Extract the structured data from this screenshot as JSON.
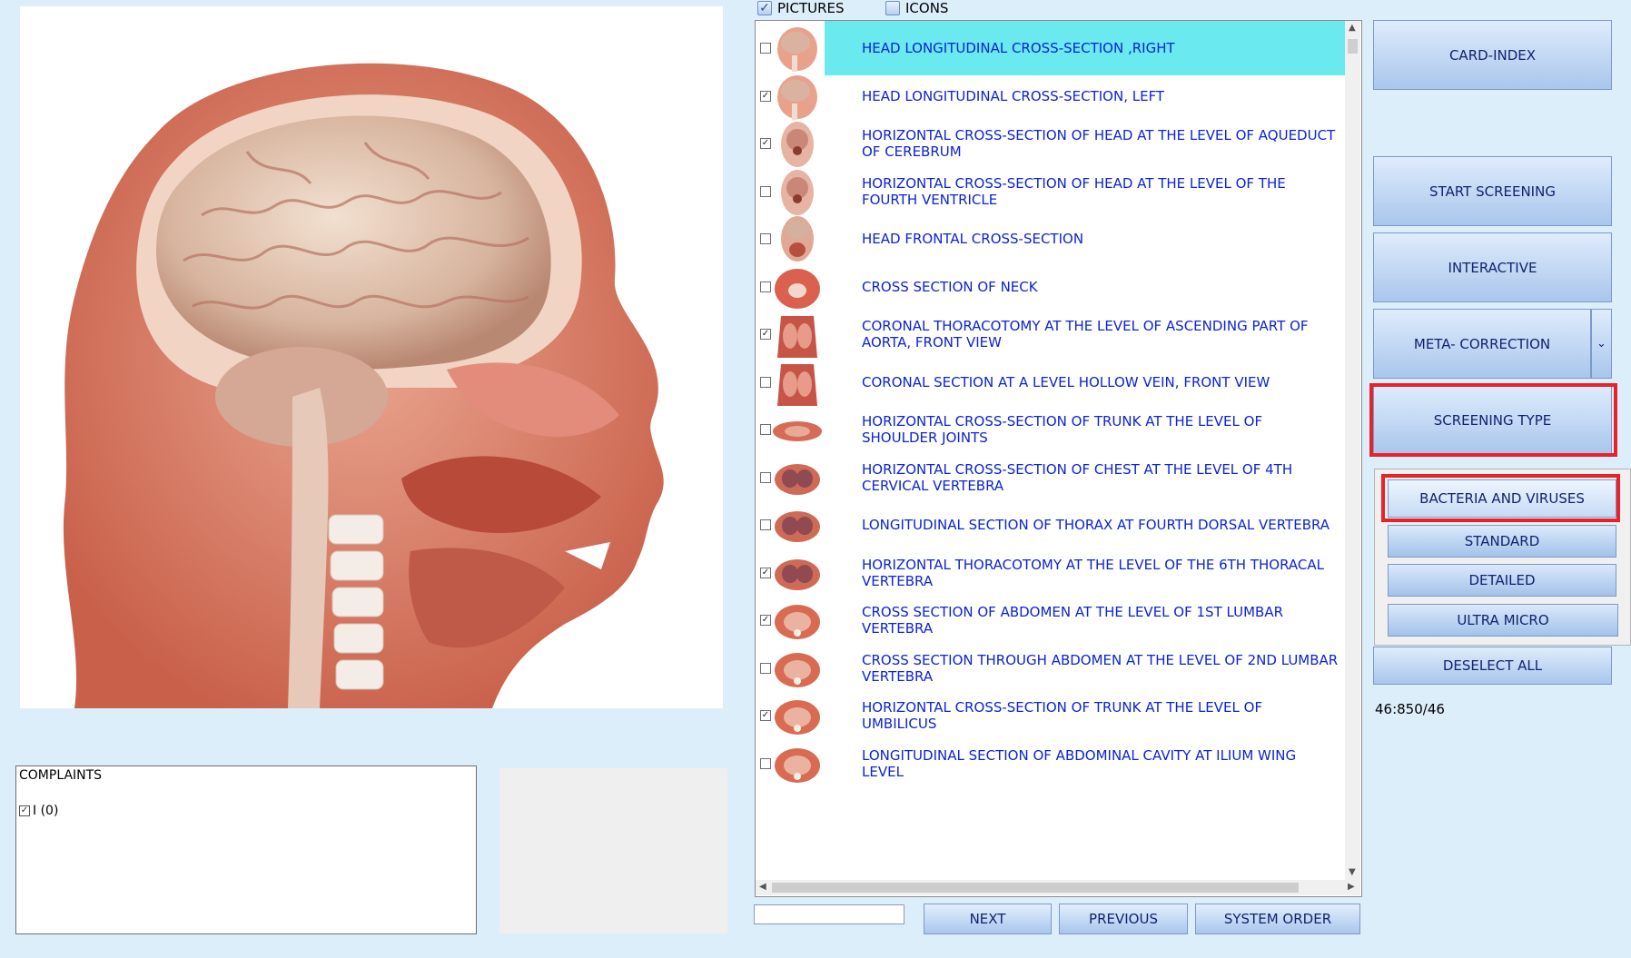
{
  "view_options": {
    "pictures": {
      "label": "PICTURES",
      "checked": true
    },
    "icons": {
      "label": "ICONS",
      "checked": false
    }
  },
  "list": {
    "items": [
      {
        "label": "HEAD LONGITUDINAL CROSS-SECTION ,RIGHT",
        "checked": false,
        "selected": true,
        "thumb": "head-side"
      },
      {
        "label": "HEAD LONGITUDINAL CROSS-SECTION, LEFT",
        "checked": true,
        "selected": false,
        "thumb": "head-side"
      },
      {
        "label": "HORIZONTAL CROSS-SECTION OF HEAD AT THE LEVEL OF AQUEDUCT OF CEREBRUM",
        "checked": true,
        "selected": false,
        "thumb": "head-top"
      },
      {
        "label": "HORIZONTAL CROSS-SECTION OF HEAD AT THE LEVEL OF THE FOURTH VENTRICLE",
        "checked": false,
        "selected": false,
        "thumb": "head-top"
      },
      {
        "label": "HEAD FRONTAL CROSS-SECTION",
        "checked": false,
        "selected": false,
        "thumb": "head-front"
      },
      {
        "label": "CROSS SECTION OF NECK",
        "checked": false,
        "selected": false,
        "thumb": "neck"
      },
      {
        "label": "CORONAL THORACOTOMY AT THE LEVEL OF ASCENDING PART OF AORTA, FRONT VIEW",
        "checked": true,
        "selected": false,
        "thumb": "torso"
      },
      {
        "label": "CORONAL SECTION AT A LEVEL HOLLOW VEIN, FRONT VIEW",
        "checked": false,
        "selected": false,
        "thumb": "torso"
      },
      {
        "label": "HORIZONTAL CROSS-SECTION OF TRUNK AT THE LEVEL OF SHOULDER JOINTS",
        "checked": false,
        "selected": false,
        "thumb": "trunk-wide"
      },
      {
        "label": "HORIZONTAL CROSS-SECTION OF CHEST AT THE LEVEL OF 4TH CERVICAL VERTEBRA",
        "checked": false,
        "selected": false,
        "thumb": "chest"
      },
      {
        "label": "LONGITUDINAL SECTION OF THORAX AT FOURTH DORSAL VERTEBRA",
        "checked": false,
        "selected": false,
        "thumb": "chest"
      },
      {
        "label": "HORIZONTAL THORACOTOMY AT THE LEVEL OF THE 6TH THORACAL VERTEBRA",
        "checked": true,
        "selected": false,
        "thumb": "chest"
      },
      {
        "label": "CROSS SECTION OF ABDOMEN AT THE LEVEL OF 1ST LUMBAR VERTEBRA",
        "checked": true,
        "selected": false,
        "thumb": "abdomen"
      },
      {
        "label": "CROSS SECTION THROUGH ABDOMEN AT THE LEVEL OF 2ND LUMBAR VERTEBRA",
        "checked": false,
        "selected": false,
        "thumb": "abdomen"
      },
      {
        "label": "HORIZONTAL CROSS-SECTION OF TRUNK AT THE LEVEL OF UMBILICUS",
        "checked": true,
        "selected": false,
        "thumb": "abdomen"
      },
      {
        "label": "LONGITUDINAL SECTION OF ABDOMINAL CAVITY AT ILIUM WING LEVEL",
        "checked": false,
        "selected": false,
        "thumb": "abdomen"
      }
    ]
  },
  "complaints": {
    "title": "COMPLAINTS",
    "items": [
      {
        "label": "I (0)",
        "checked": true
      }
    ]
  },
  "search": {
    "value": ""
  },
  "nav": {
    "next": "NEXT",
    "previous": "PREVIOUS",
    "system_order": "SYSTEM ORDER"
  },
  "right_panel": {
    "card_index": "CARD-INDEX",
    "start_screening": "START SCREENING",
    "interactive": "INTERACTIVE",
    "meta_correction": "META- CORRECTION",
    "screening_type": "SCREENING  TYPE",
    "submenu": {
      "bacteria": "BACTERIA AND VIRUSES",
      "standard": "STANDARD",
      "detailed": "DETAILED",
      "ultra_micro": "ULTRA MICRO"
    },
    "deselect_all": "DESELECT ALL",
    "counter": "46:850/46"
  },
  "colors": {
    "background": "#ddeefb",
    "list_text": "#0b24d4",
    "selected_row": "#6ae9ef",
    "highlight_outline": "#e8222a"
  }
}
